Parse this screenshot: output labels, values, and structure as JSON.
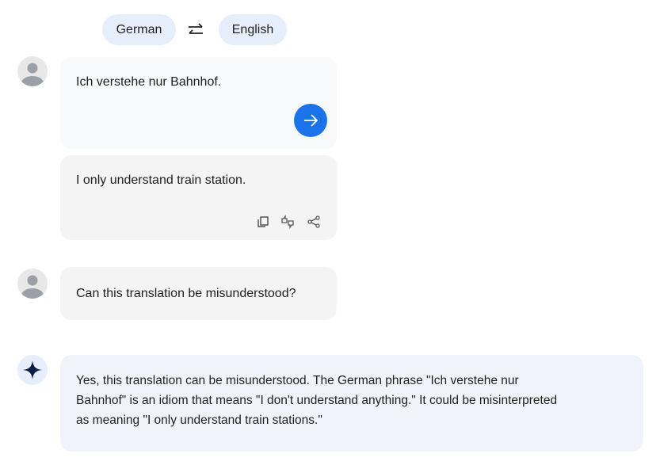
{
  "language_bar": {
    "source": "German",
    "target": "English",
    "swap_icon": "swap-arrows-icon"
  },
  "messages": [
    {
      "role": "user",
      "type": "translation_input",
      "text": "Ich verstehe nur Bahnhof.",
      "action": "translate-arrow-icon"
    },
    {
      "role": "system",
      "type": "translation_output",
      "text": "I only understand train station.",
      "actions": [
        "copy-icon",
        "feedback-thumbs-icon",
        "share-icon"
      ]
    },
    {
      "role": "user",
      "text": "Can this translation be misunderstood?"
    },
    {
      "role": "assistant",
      "lines": [
        "Yes, this translation can be misunderstood. The German phrase \"Ich verstehe nur",
        "Bahnhof\" is an idiom that means \"I don't understand anything.\" It could be misinterpreted",
        "as meaning \"I only understand train stations.\""
      ]
    }
  ],
  "colors": {
    "accent": "#1a73e8",
    "chip": "#e6eefb",
    "assistant_bg": "#f0f4fa"
  }
}
